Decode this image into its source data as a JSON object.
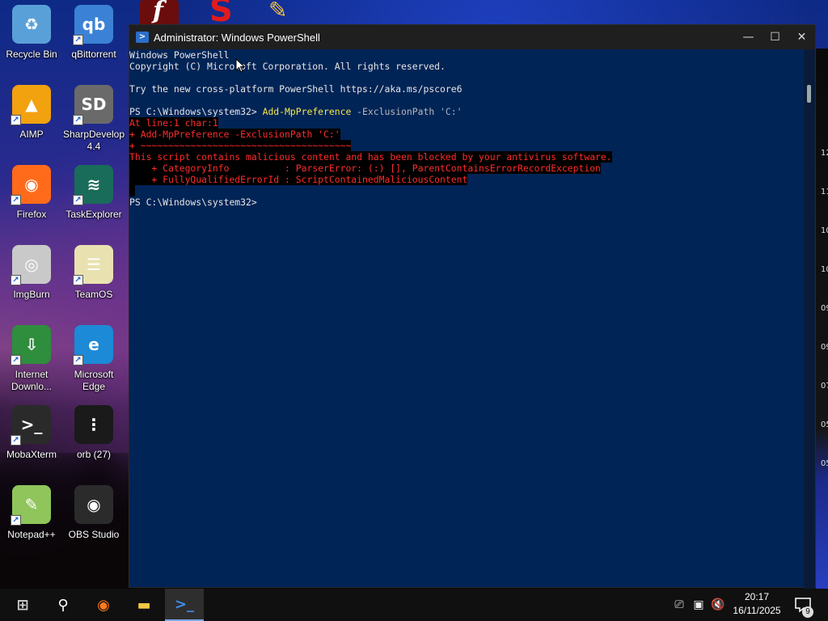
{
  "desktop": {
    "icons": [
      {
        "id": "recycle-bin",
        "label": "Recycle Bin",
        "icon": "recycle-bin-icon",
        "color": "#5aa0d8",
        "glyph": "♻",
        "shortcut": false
      },
      {
        "id": "qbittorrent",
        "label": "qBittorrent",
        "icon": "qbittorrent-icon",
        "color": "#3b82d6",
        "glyph": "qb",
        "shortcut": true
      },
      {
        "id": "aimp",
        "label": "AIMP",
        "icon": "aimp-icon",
        "color": "#f2a10f",
        "glyph": "▲",
        "shortcut": true
      },
      {
        "id": "sharpdevelop",
        "label": "SharpDevelop 4.4",
        "icon": "sharpdevelop-icon",
        "color": "#6a6a6a",
        "glyph": "SD",
        "shortcut": true
      },
      {
        "id": "firefox",
        "label": "Firefox",
        "icon": "firefox-icon",
        "color": "#ff6b1a",
        "glyph": "◉",
        "shortcut": true
      },
      {
        "id": "taskexplorer",
        "label": "TaskExplorer",
        "icon": "taskexplorer-icon",
        "color": "#1a6c5a",
        "glyph": "≋",
        "shortcut": true
      },
      {
        "id": "imgburn",
        "label": "ImgBurn",
        "icon": "imgburn-icon",
        "color": "#c9c9c9",
        "glyph": "◎",
        "shortcut": true
      },
      {
        "id": "teamos",
        "label": "TeamOS",
        "icon": "teamos-icon",
        "color": "#e9e2b0",
        "glyph": "☰",
        "shortcut": true
      },
      {
        "id": "internet-download",
        "label": "Internet Downlo...",
        "icon": "internet-download-manager-icon",
        "color": "#2f8d3e",
        "glyph": "⇩",
        "shortcut": true
      },
      {
        "id": "microsoft-edge",
        "label": "Microsoft Edge",
        "icon": "edge-icon",
        "color": "#1c8ad6",
        "glyph": "e",
        "shortcut": true
      },
      {
        "id": "mobaxterm",
        "label": "MobaXterm",
        "icon": "mobaxterm-icon",
        "color": "#2a2a2a",
        "glyph": ">_",
        "shortcut": true
      },
      {
        "id": "orb",
        "label": "orb (27)",
        "icon": "orb-file-icon",
        "color": "#1a1a1a",
        "glyph": "⋮",
        "shortcut": false
      },
      {
        "id": "notepadpp",
        "label": "Notepad++",
        "icon": "notepadpp-icon",
        "color": "#8fc55a",
        "glyph": "✎",
        "shortcut": true
      },
      {
        "id": "obs-studio",
        "label": "OBS Studio",
        "icon": "obs-studio-icon",
        "color": "#2b2b2b",
        "glyph": "◉",
        "shortcut": false
      }
    ]
  },
  "window": {
    "title": "Administrator: Windows PowerShell",
    "controls": {
      "minimize": "—",
      "maximize": "☐",
      "close": "✕"
    },
    "lines": [
      {
        "segments": [
          {
            "t": "Windows PowerShell",
            "c": "plain"
          }
        ]
      },
      {
        "segments": [
          {
            "t": "Copyright (C) Microsoft Corporation. All rights reserved.",
            "c": "plain"
          }
        ]
      },
      {
        "segments": [
          {
            "t": "",
            "c": "plain"
          }
        ]
      },
      {
        "segments": [
          {
            "t": "Try the new cross-platform PowerShell https://aka.ms/pscore6",
            "c": "plain"
          }
        ]
      },
      {
        "segments": [
          {
            "t": "",
            "c": "plain"
          }
        ]
      },
      {
        "segments": [
          {
            "t": "PS C:\\Windows\\system32> ",
            "c": "plain"
          },
          {
            "t": "Add-MpPreference",
            "c": "cmd"
          },
          {
            "t": " -ExclusionPath ",
            "c": "param"
          },
          {
            "t": "'C:'",
            "c": "str"
          }
        ]
      },
      {
        "segments": [
          {
            "t": "At line:1 char:1",
            "c": "err"
          }
        ]
      },
      {
        "segments": [
          {
            "t": "+ Add-MpPreference -ExclusionPath 'C:'",
            "c": "err"
          }
        ]
      },
      {
        "segments": [
          {
            "t": "+ ~~~~~~~~~~~~~~~~~~~~~~~~~~~~~~~~~~~~~~",
            "c": "err"
          }
        ]
      },
      {
        "segments": [
          {
            "t": "This script contains malicious content and has been blocked by your antivirus software.",
            "c": "err"
          }
        ]
      },
      {
        "segments": [
          {
            "t": "    + CategoryInfo          : ParserError: (:) [], ParentContainsErrorRecordException",
            "c": "err"
          }
        ]
      },
      {
        "segments": [
          {
            "t": "    + FullyQualifiedErrorId : ScriptContainedMaliciousContent",
            "c": "err"
          }
        ]
      },
      {
        "segments": [
          {
            "t": " ",
            "c": "err"
          }
        ]
      },
      {
        "segments": [
          {
            "t": "PS C:\\Windows\\system32>",
            "c": "plain"
          }
        ]
      }
    ]
  },
  "right_strip_ticks": [
    "12",
    "11",
    "10",
    "10",
    "09",
    "09",
    "07",
    "05",
    "05"
  ],
  "taskbar": {
    "items": [
      {
        "id": "start",
        "icon": "windows-start-icon",
        "glyph": "⊞",
        "active": false
      },
      {
        "id": "search",
        "icon": "search-icon",
        "glyph": "⚲",
        "active": false
      },
      {
        "id": "firefox",
        "icon": "firefox-icon",
        "glyph": "◉",
        "active": false
      },
      {
        "id": "file-explorer",
        "icon": "file-explorer-icon",
        "glyph": "▬",
        "active": false
      },
      {
        "id": "powershell",
        "icon": "powershell-icon",
        "glyph": ">_",
        "active": true
      }
    ],
    "tray": [
      {
        "id": "meet-now",
        "icon": "meet-now-icon",
        "glyph": "⎚"
      },
      {
        "id": "network",
        "icon": "network-disconnected-icon",
        "glyph": "▣"
      },
      {
        "id": "volume",
        "icon": "volume-muted-icon",
        "glyph": "🔇"
      }
    ],
    "time": "20:17",
    "date": "16/11/2025",
    "notification_count": "9"
  },
  "colors": {
    "console_bg": "#012456",
    "cmd": "#f4e74a",
    "error": "#ff2b2b"
  }
}
